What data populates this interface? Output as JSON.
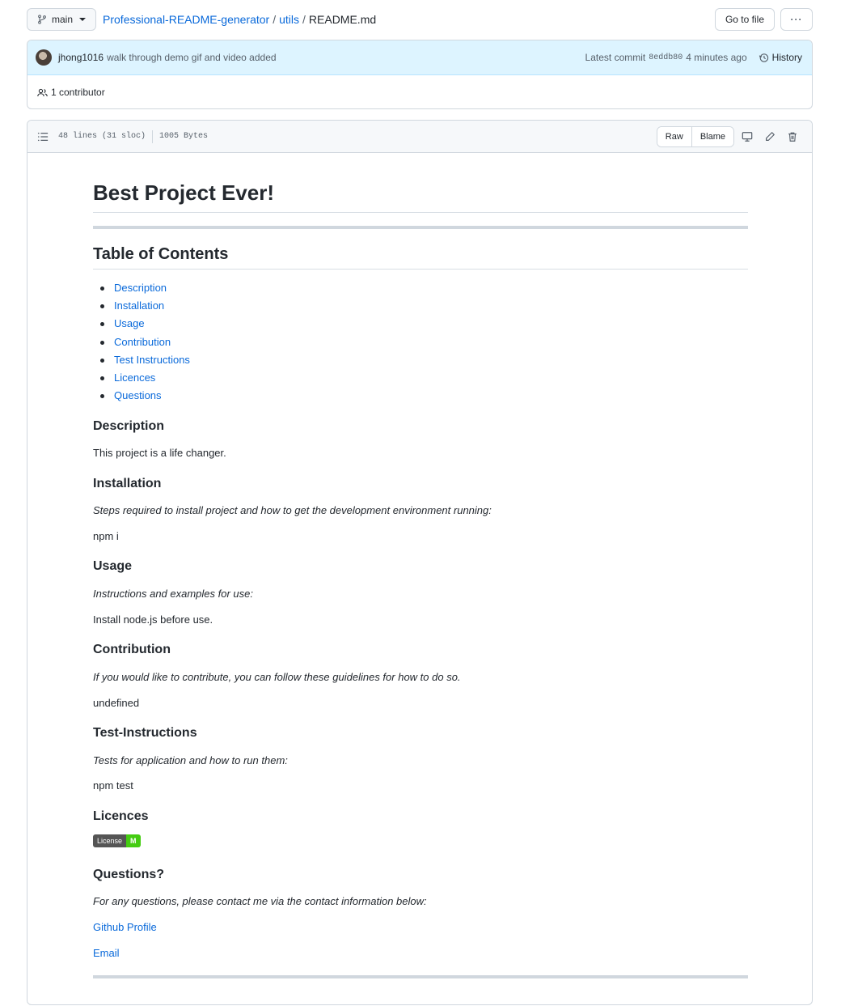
{
  "branch": {
    "name": "main"
  },
  "breadcrumb": {
    "repo": "Professional-README-generator",
    "folder": "utils",
    "sep": "/",
    "file": "README.md"
  },
  "top_actions": {
    "go_to_file": "Go to file",
    "more": "···"
  },
  "commit": {
    "author": "jhong1016",
    "message": "walk through demo gif and video added",
    "latest_label": "Latest commit",
    "sha": "8eddb80",
    "time": "4 minutes ago",
    "history_label": "History"
  },
  "contributors": {
    "label": "1 contributor"
  },
  "file": {
    "lines": "48 lines (31 sloc)",
    "size": "1005 Bytes",
    "raw_label": "Raw",
    "blame_label": "Blame"
  },
  "readme": {
    "title": "Best Project Ever!",
    "toc_heading": "Table of Contents",
    "toc": [
      "Description",
      "Installation",
      "Usage",
      "Contribution",
      "Test Instructions",
      "Licences",
      "Questions"
    ],
    "description": {
      "heading": "Description",
      "text": "This project is a life changer."
    },
    "installation": {
      "heading": "Installation",
      "note": "Steps required to install project and how to get the development environment running:",
      "text": "npm i"
    },
    "usage": {
      "heading": "Usage",
      "note": "Instructions and examples for use:",
      "text": "Install node.js before use."
    },
    "contribution": {
      "heading": "Contribution",
      "note": "If you would like to contribute, you can follow these guidelines for how to do so.",
      "text": "undefined"
    },
    "tests": {
      "heading": "Test-Instructions",
      "note": "Tests for application and how to run them:",
      "text": "npm test"
    },
    "licences": {
      "heading": "Licences",
      "badge_label": "License",
      "badge_value": "M"
    },
    "questions": {
      "heading": "Questions?",
      "note": "For any questions, please contact me via the contact information below:",
      "github": "Github Profile",
      "email": "Email"
    }
  },
  "colors": {
    "link": "#0969da",
    "commit_bg": "#ddf4ff",
    "header_bg": "#f6f8fa",
    "badge_green": "#44cc11"
  }
}
